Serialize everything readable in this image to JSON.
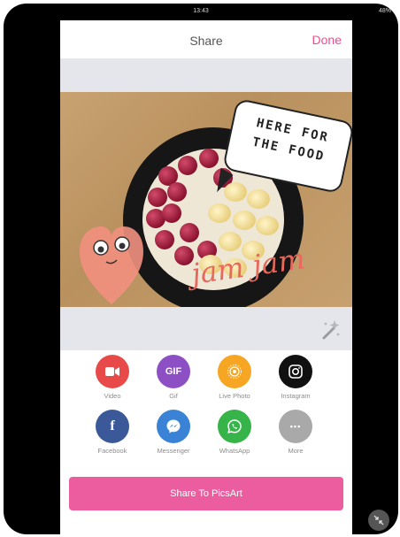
{
  "status_bar": {
    "time": "13:43",
    "battery": "48%"
  },
  "header": {
    "title": "Share",
    "done_label": "Done"
  },
  "photo": {
    "speech_bubble_text": "HERE FOR THE FOOD",
    "sticker_text": "jam jam"
  },
  "share_targets": [
    {
      "label": "Video",
      "icon": "video-camera-icon",
      "color": "#e84a4a"
    },
    {
      "label": "Gif",
      "icon": "gif-icon",
      "glyph": "GIF",
      "color": "#8d4fc4"
    },
    {
      "label": "Live Photo",
      "icon": "live-photo-icon",
      "color": "#f6a623"
    },
    {
      "label": "Instagram",
      "icon": "instagram-icon",
      "color": "#111111"
    },
    {
      "label": "Facebook",
      "icon": "facebook-icon",
      "glyph": "f",
      "color": "#3b5998"
    },
    {
      "label": "Messenger",
      "icon": "messenger-icon",
      "color": "#3a82d6"
    },
    {
      "label": "WhatsApp",
      "icon": "whatsapp-icon",
      "color": "#36b449"
    },
    {
      "label": "More",
      "icon": "more-dots-icon",
      "glyph": "•••",
      "color": "#a9a9a9"
    }
  ],
  "primary_action": {
    "label": "Share To PicsArt",
    "color": "#ec5da0"
  },
  "accent_color": "#ec4d8e"
}
